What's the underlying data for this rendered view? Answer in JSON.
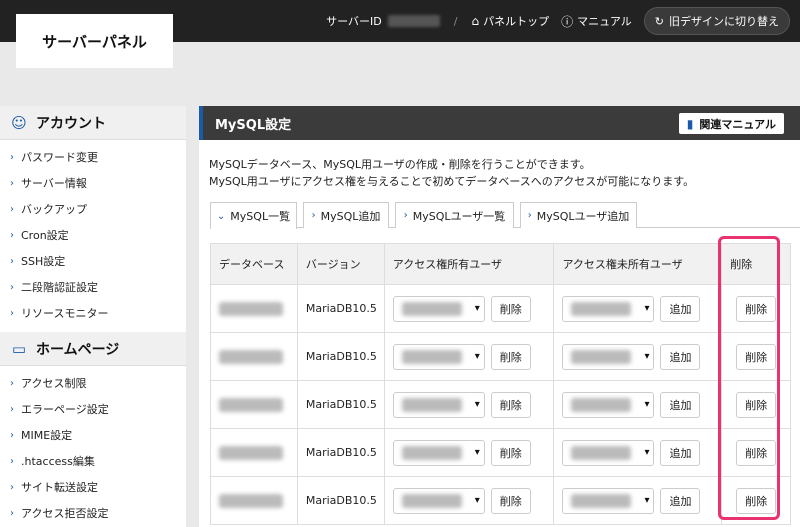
{
  "header": {
    "logo": "サーバーパネル",
    "server_id_label": "サーバーID",
    "slash": "/",
    "panel_top": "パネルトップ",
    "manual": "マニュアル",
    "old_design": "旧デザインに切り替え"
  },
  "sidebar": {
    "sections": [
      {
        "title": "アカウント",
        "icon": "user-icon",
        "items": [
          "パスワード変更",
          "サーバー情報",
          "バックアップ",
          "Cron設定",
          "SSH設定",
          "二段階認証設定",
          "リソースモニター"
        ]
      },
      {
        "title": "ホームページ",
        "icon": "window-icon",
        "items": [
          "アクセス制限",
          "エラーページ設定",
          "MIME設定",
          ".htaccess編集",
          "サイト転送設定",
          "アクセス拒否設定"
        ]
      }
    ]
  },
  "main": {
    "title": "MySQL設定",
    "manual_btn": "関連マニュアル",
    "desc1": "MySQLデータベース、MySQL用ユーザの作成・削除を行うことができます。",
    "desc2": "MySQL用ユーザにアクセス権を与えることで初めてデータベースへのアクセスが可能になります。",
    "tabs": [
      "MySQL一覧",
      "MySQL追加",
      "MySQLユーザ一覧",
      "MySQLユーザ追加"
    ],
    "table": {
      "headers": [
        "データベース",
        "バージョン",
        "アクセス権所有ユーザ",
        "アクセス権未所有ユーザ",
        "削除"
      ],
      "rows": [
        {
          "version": "MariaDB10.5",
          "del_user_btn": "削除",
          "add_btn": "追加",
          "delete_btn": "削除"
        },
        {
          "version": "MariaDB10.5",
          "del_user_btn": "削除",
          "add_btn": "追加",
          "delete_btn": "削除"
        },
        {
          "version": "MariaDB10.5",
          "del_user_btn": "削除",
          "add_btn": "追加",
          "delete_btn": "削除"
        },
        {
          "version": "MariaDB10.5",
          "del_user_btn": "削除",
          "add_btn": "追加",
          "delete_btn": "削除"
        },
        {
          "version": "MariaDB10.5",
          "del_user_btn": "削除",
          "add_btn": "追加",
          "delete_btn": "削除"
        }
      ]
    }
  },
  "colors": {
    "accent": "#1a5aa8",
    "header_bg": "#222222",
    "highlight": "#e8336e"
  }
}
